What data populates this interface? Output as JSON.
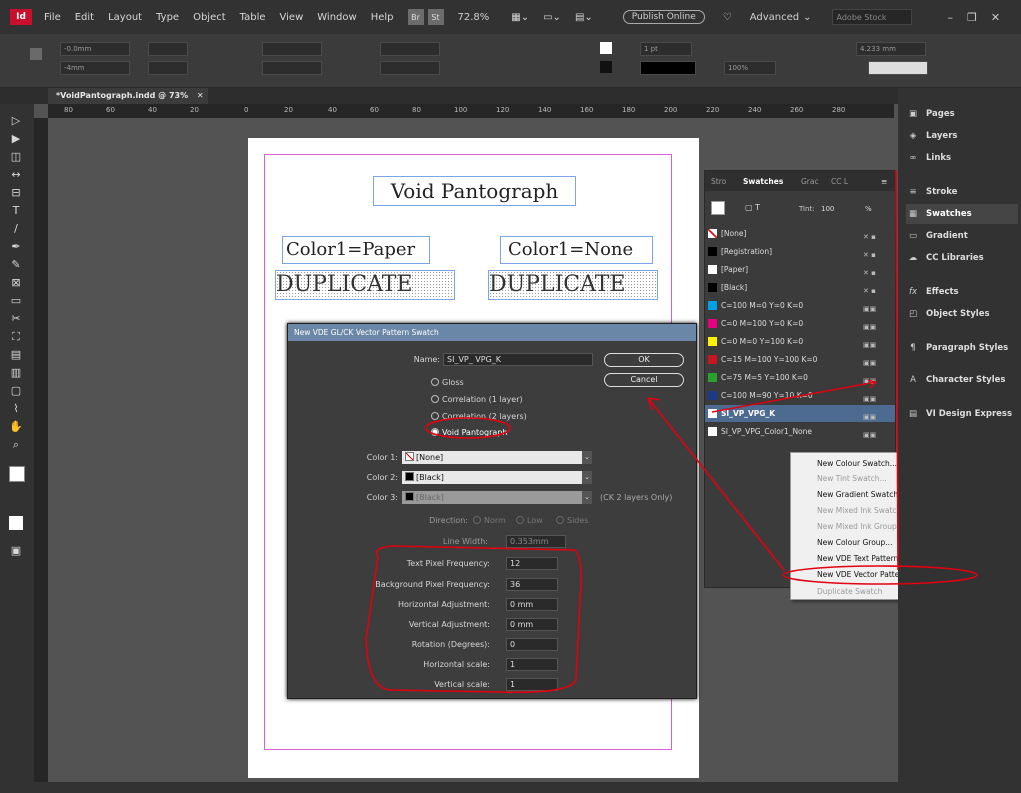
{
  "app": {
    "logo": "Id",
    "bridge": "Br",
    "stock": "St",
    "zoom": "72.8%",
    "publish": "Publish Online",
    "workspace": "Advanced",
    "search_placeholder": "Adobe Stock"
  },
  "menu": [
    "File",
    "Edit",
    "Layout",
    "Type",
    "Object",
    "Table",
    "View",
    "Window",
    "Help"
  ],
  "control": {
    "x": "-0.0mm",
    "y": "-4mm",
    "stroke_weight": "1 pt",
    "opacity": "100%",
    "measure": "4.233 mm"
  },
  "document": {
    "tab": "*VoidPantograph.indd @ 73%"
  },
  "ruler": [
    "80",
    "60",
    "40",
    "20",
    "0",
    "20",
    "40",
    "60",
    "80",
    "100",
    "120",
    "140",
    "160",
    "180",
    "200",
    "220",
    "240",
    "260",
    "280"
  ],
  "page": {
    "title": "Void Pantograph",
    "color1_paper": "Color1=Paper",
    "color1_none": "Color1=None",
    "dup1": "DUPLICATE",
    "dup2": "DUPLICATE"
  },
  "dialog": {
    "title": "New VDE GL/CK Vector Pattern Swatch",
    "name_label": "Name:",
    "name_value": "SI_VP_ VPG_K",
    "ok": "OK",
    "cancel": "Cancel",
    "radios": [
      "Gloss",
      "Correlation (1 layer)",
      "Correlation (2 layers)",
      "Void Pantograph"
    ],
    "color1_label": "Color 1:",
    "color1_value": "[None]",
    "color2_label": "Color 2:",
    "color2_value": "[Black]",
    "color3_label": "Color 3:",
    "color3_value": "[Black]",
    "color3_note": "(CK 2 layers Only)",
    "direction_label": "Direction:",
    "direction_opts": [
      "Norm",
      "Low",
      "Sides"
    ],
    "linewidth_label": "Line Width:",
    "linewidth_value": "0.353mm",
    "fields": [
      {
        "label": "Text Pixel Frequency:",
        "value": "12"
      },
      {
        "label": "Background Pixel Frequency:",
        "value": "36"
      },
      {
        "label": "Horizontal Adjustment:",
        "value": "0 mm"
      },
      {
        "label": "Vertical Adjustment:",
        "value": "0 mm"
      },
      {
        "label": "Rotation (Degrees):",
        "value": "0"
      },
      {
        "label": "Horizontal scale:",
        "value": "1"
      },
      {
        "label": "Vertical scale:",
        "value": "1"
      }
    ]
  },
  "swatches": {
    "tabs": [
      "Stro",
      "Swatches",
      "Grac",
      "CC L"
    ],
    "tint_label": "Tint:",
    "tint_value": "100",
    "tint_unit": "%",
    "rows": [
      {
        "name": "[None]",
        "color": "#ffffff"
      },
      {
        "name": "[Registration]",
        "color": "#000000"
      },
      {
        "name": "[Paper]",
        "color": "#ffffff"
      },
      {
        "name": "[Black]",
        "color": "#000000"
      },
      {
        "name": "C=100 M=0 Y=0 K=0",
        "color": "#00a0e9"
      },
      {
        "name": "C=0 M=100 Y=0 K=0",
        "color": "#e4007f"
      },
      {
        "name": "C=0 M=0 Y=100 K=0",
        "color": "#fff100"
      },
      {
        "name": "C=15 M=100 Y=100 K=0",
        "color": "#c8161e"
      },
      {
        "name": "C=75 M=5 Y=100 K=0",
        "color": "#29a12f"
      },
      {
        "name": "C=100 M=90 Y=10 K=0",
        "color": "#1d3a8a"
      },
      {
        "name": "SI_VP_VPG_K",
        "color": "#ffffff"
      },
      {
        "name": "SI_VP_VPG_Color1_None",
        "color": "#ffffff"
      }
    ]
  },
  "context_menu": [
    {
      "label": "New Colour Swatch...",
      "disabled": false
    },
    {
      "label": "New Tint Swatch...",
      "disabled": true
    },
    {
      "label": "New Gradient Swatch...",
      "disabled": false
    },
    {
      "label": "New Mixed Ink Swatch...",
      "disabled": true
    },
    {
      "label": "New Mixed Ink Group...",
      "disabled": true
    },
    {
      "label": "New Colour Group...",
      "disabled": false
    },
    {
      "label": "New VDE Text Pattern Swatch...",
      "disabled": false
    },
    {
      "label": "New VDE Vector Pattern Swatch...",
      "disabled": false
    },
    {
      "label": "Duplicate Swatch",
      "disabled": true
    }
  ],
  "dock": [
    "Pages",
    "Layers",
    "Links",
    "Stroke",
    "Swatches",
    "Gradient",
    "CC Libraries",
    "Effects",
    "Object Styles",
    "Paragraph Styles",
    "Character Styles",
    "VI Design Express"
  ],
  "colors": {
    "accent": "#e3000f",
    "selection": "#4d6a90",
    "margin": "#d85fd8",
    "frame": "#7aa5e8"
  }
}
